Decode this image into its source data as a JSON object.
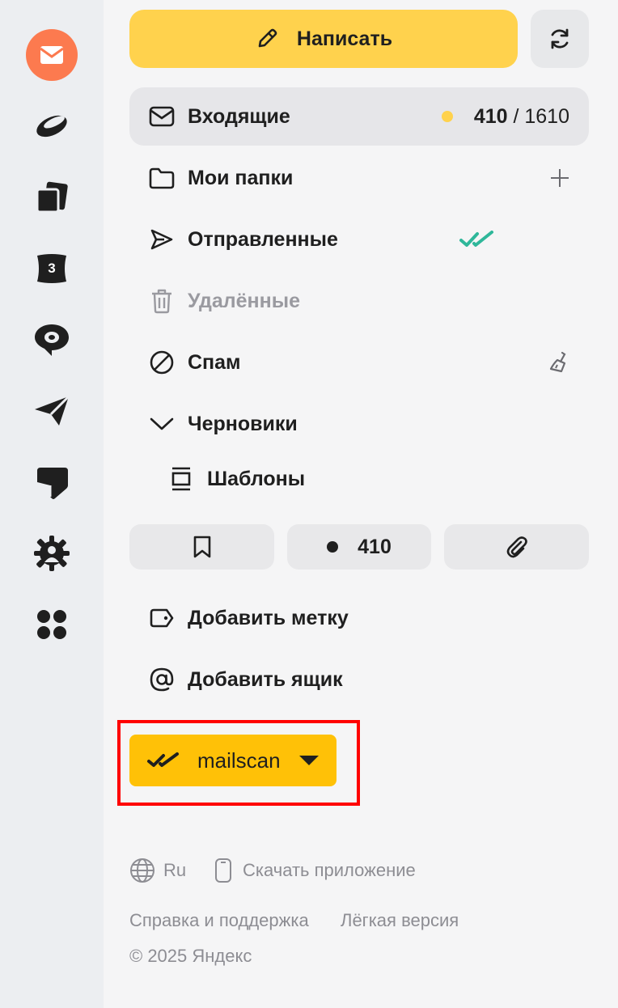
{
  "rail": {
    "items": [
      {
        "name": "mail-app-icon"
      },
      {
        "name": "disk-app-icon"
      },
      {
        "name": "docs-app-icon"
      },
      {
        "name": "calendar-app-icon",
        "badge": "3"
      },
      {
        "name": "messenger-app-icon"
      },
      {
        "name": "telemost-app-icon"
      },
      {
        "name": "notes-app-icon"
      },
      {
        "name": "contacts-app-icon"
      },
      {
        "name": "all-services-icon"
      }
    ]
  },
  "toolbar": {
    "compose_label": "Написать"
  },
  "folders": {
    "inbox": {
      "label": "Входящие",
      "unread": "410",
      "separator": " / ",
      "total": "1610"
    },
    "my_folders": {
      "label": "Мои папки"
    },
    "sent": {
      "label": "Отправленные"
    },
    "deleted": {
      "label": "Удалённые"
    },
    "spam": {
      "label": "Спам"
    },
    "drafts": {
      "label": "Черновики"
    },
    "templates": {
      "label": "Шаблоны"
    }
  },
  "filters": {
    "unread_count": "410"
  },
  "actions": {
    "add_label": "Добавить метку",
    "add_mailbox": "Добавить ящик"
  },
  "mailscan": {
    "label": "mailscan"
  },
  "footer": {
    "language": "Ru",
    "download_app": "Скачать приложение",
    "help": "Справка и поддержка",
    "light_version": "Лёгкая версия",
    "copyright": "© 2025 Яндекс"
  },
  "colors": {
    "accent_yellow": "#ffd24d",
    "mailscan_yellow": "#ffc107",
    "mail_orange": "#fc7a4f",
    "sent_check_teal": "#2fb79a",
    "highlight_red": "#ff0000"
  }
}
